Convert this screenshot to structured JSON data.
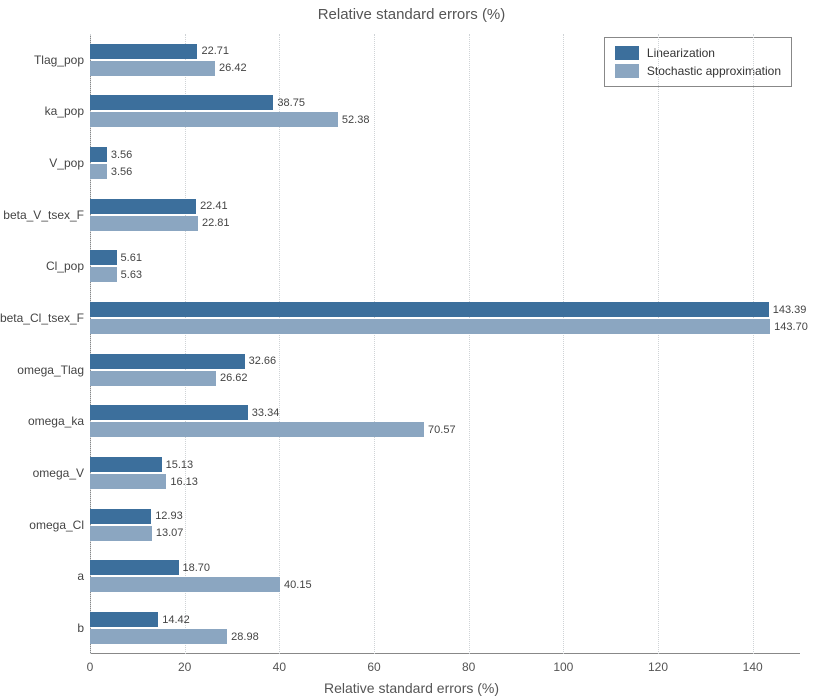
{
  "chart_data": {
    "type": "bar",
    "orientation": "horizontal",
    "title": "Relative standard errors (%)",
    "xlabel": "Relative standard errors (%)",
    "ylabel": "",
    "xlim": [
      0,
      150
    ],
    "xticks": [
      0,
      20,
      40,
      60,
      80,
      100,
      120,
      140
    ],
    "categories": [
      "Tlag_pop",
      "ka_pop",
      "V_pop",
      "beta_V_tsex_F",
      "Cl_pop",
      "beta_Cl_tsex_F",
      "omega_Tlag",
      "omega_ka",
      "omega_V",
      "omega_Cl",
      "a",
      "b"
    ],
    "series": [
      {
        "name": "Linearization",
        "color": "#3c6f9c",
        "values": [
          22.71,
          38.75,
          3.56,
          22.41,
          5.61,
          143.39,
          32.66,
          33.34,
          15.13,
          12.93,
          18.7,
          14.42
        ]
      },
      {
        "name": "Stochastic approximation",
        "color": "#8ba6c1",
        "values": [
          26.42,
          52.38,
          3.56,
          22.81,
          5.63,
          143.7,
          26.62,
          70.57,
          16.13,
          13.07,
          40.15,
          28.98
        ]
      }
    ],
    "legend_position": "top-right"
  }
}
